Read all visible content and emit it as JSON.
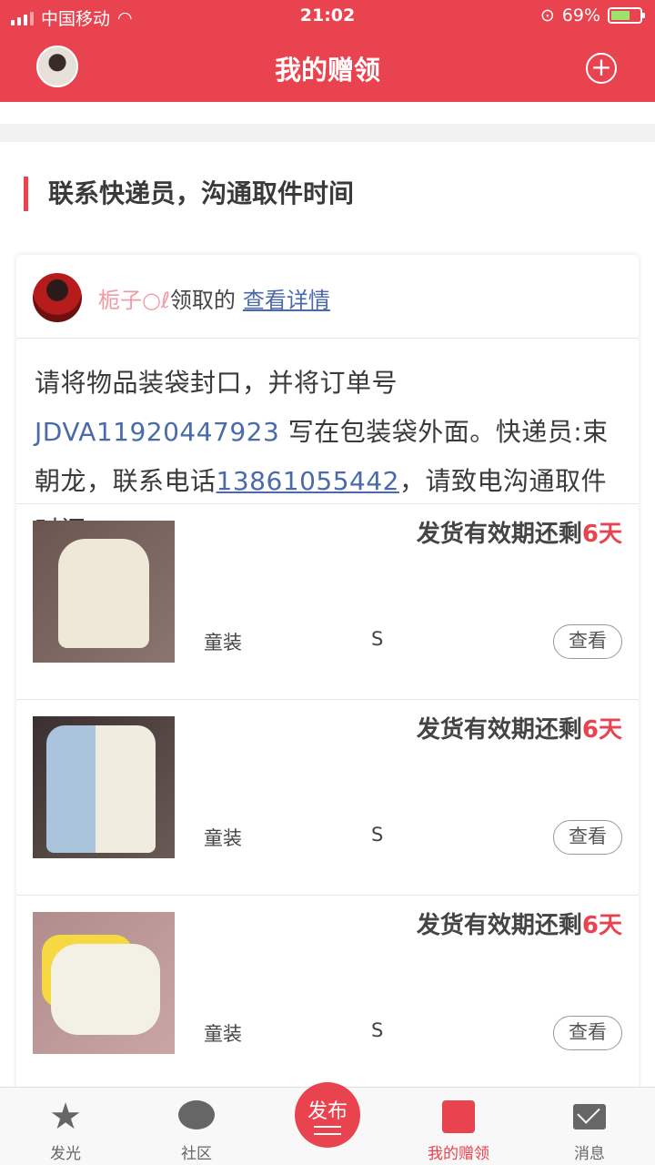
{
  "status_bar": {
    "carrier": "中国移动",
    "time": "21:02",
    "battery": "69%"
  },
  "nav": {
    "title": "我的赠领",
    "add_icon": "plus-circle-icon"
  },
  "section": {
    "title": "联系快递员，沟通取件时间"
  },
  "card": {
    "user_name": "栀子○ℓ",
    "action_text": "领取的",
    "detail_link": "查看详情",
    "notice": {
      "prefix": "请将物品装袋封口，并将订单号 ",
      "order_no": "JDVA11920447923",
      "middle": " 写在包装袋外面。快递员:束朝龙，联系电话",
      "phone": "13861055442",
      "suffix": "，请致电沟通取件时间。"
    },
    "items": [
      {
        "expire_prefix": "发货有效期还剩",
        "expire_days": "6天",
        "category": "童装",
        "size": "S",
        "view_label": "查看"
      },
      {
        "expire_prefix": "发货有效期还剩",
        "expire_days": "6天",
        "category": "童装",
        "size": "S",
        "view_label": "查看"
      },
      {
        "expire_prefix": "发货有效期还剩",
        "expire_days": "6天",
        "category": "童装",
        "size": "S",
        "view_label": "查看"
      }
    ]
  },
  "tabs": [
    {
      "label": "发光",
      "icon": "star-icon"
    },
    {
      "label": "社区",
      "icon": "chat-icon"
    },
    {
      "label": "发布",
      "icon": "publish-icon"
    },
    {
      "label": "我的赠领",
      "icon": "gift-icon"
    },
    {
      "label": "消息",
      "icon": "mail-icon"
    }
  ],
  "colors": {
    "accent": "#e8434f",
    "link": "#4a6aa8"
  }
}
